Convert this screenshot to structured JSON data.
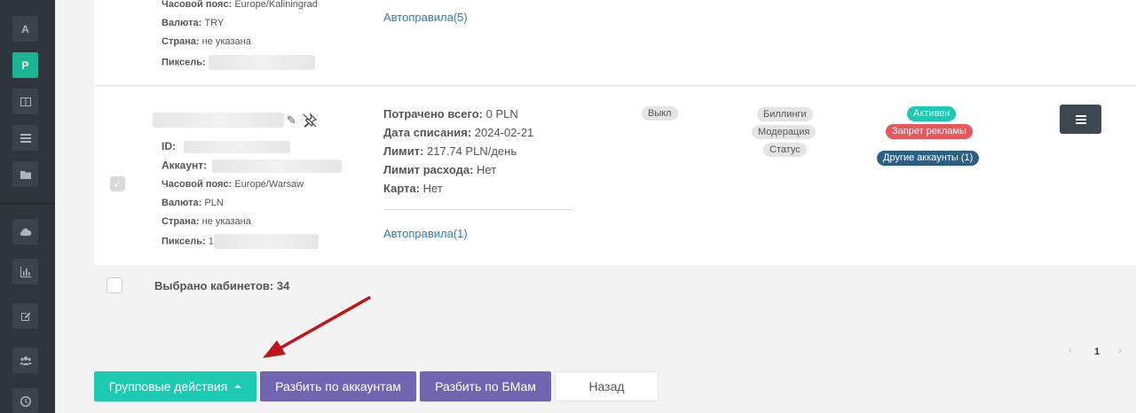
{
  "sidebar": {
    "items": [
      {
        "label": "A",
        "icon": "letter-a"
      },
      {
        "label": "P",
        "icon": "letter-p"
      },
      {
        "label": "",
        "icon": "columns-icon"
      },
      {
        "label": "",
        "icon": "list-icon"
      },
      {
        "label": "",
        "icon": "folder-icon"
      },
      {
        "label": "",
        "icon": "cloud-upload-icon"
      },
      {
        "label": "",
        "icon": "bar-chart-icon"
      },
      {
        "label": "",
        "icon": "edit-icon"
      },
      {
        "label": "",
        "icon": "users-icon"
      },
      {
        "label": "",
        "icon": "clock-icon"
      }
    ],
    "accent": "#1ab394"
  },
  "top_row": {
    "timezone_label": "Часовой пояс:",
    "timezone": "Europe/Kaliningrad",
    "currency_label": "Валюта:",
    "currency": "TRY",
    "country_label": "Страна:",
    "country": "не указана",
    "pixel_label": "Пиксель:",
    "autorules": "Автоправила(5)"
  },
  "main_row": {
    "id_label": "ID:",
    "account_label": "Аккаунт:",
    "timezone_label": "Часовой пояс:",
    "timezone": "Europe/Warsaw",
    "currency_label": "Валюта:",
    "currency": "PLN",
    "country_label": "Страна:",
    "country": "не указана",
    "pixel_label": "Пиксель:",
    "pixel_prefix": "1",
    "spent_label": "Потрачено всего:",
    "spent": "0 PLN",
    "charge_date_label": "Дата списания:",
    "charge_date": "2024-02-21",
    "limit_label": "Лимит:",
    "limit": "217.74 PLN/день",
    "spend_limit_label": "Лимит расхода:",
    "spend_limit": "Нет",
    "card_label": "Карта:",
    "card": "Нет",
    "autorules": "Автоправила(1)",
    "toggle": "Выкл",
    "pills": [
      "Биллинги",
      "Модерация",
      "Статус"
    ],
    "badges": [
      {
        "text": "Активен",
        "color": "#1ccab1"
      },
      {
        "text": "Запрет рекламы",
        "color": "#e8575a"
      },
      {
        "text": "Другие аккаунты (1)",
        "color": "#2c5f86"
      }
    ]
  },
  "footer": {
    "selected_text": "Выбрано кабинетов: 34"
  },
  "pagination": {
    "prev": "‹",
    "page": "1",
    "next": "›"
  },
  "buttons": {
    "group_actions": "Групповые действия",
    "split_accounts": "Разбить по аккаунтам",
    "split_bm": "Разбить по БМам",
    "back": "Назад"
  },
  "colors": {
    "teal": "#1ccab1",
    "purple": "#7165b2",
    "arrow": "#c0141a"
  }
}
